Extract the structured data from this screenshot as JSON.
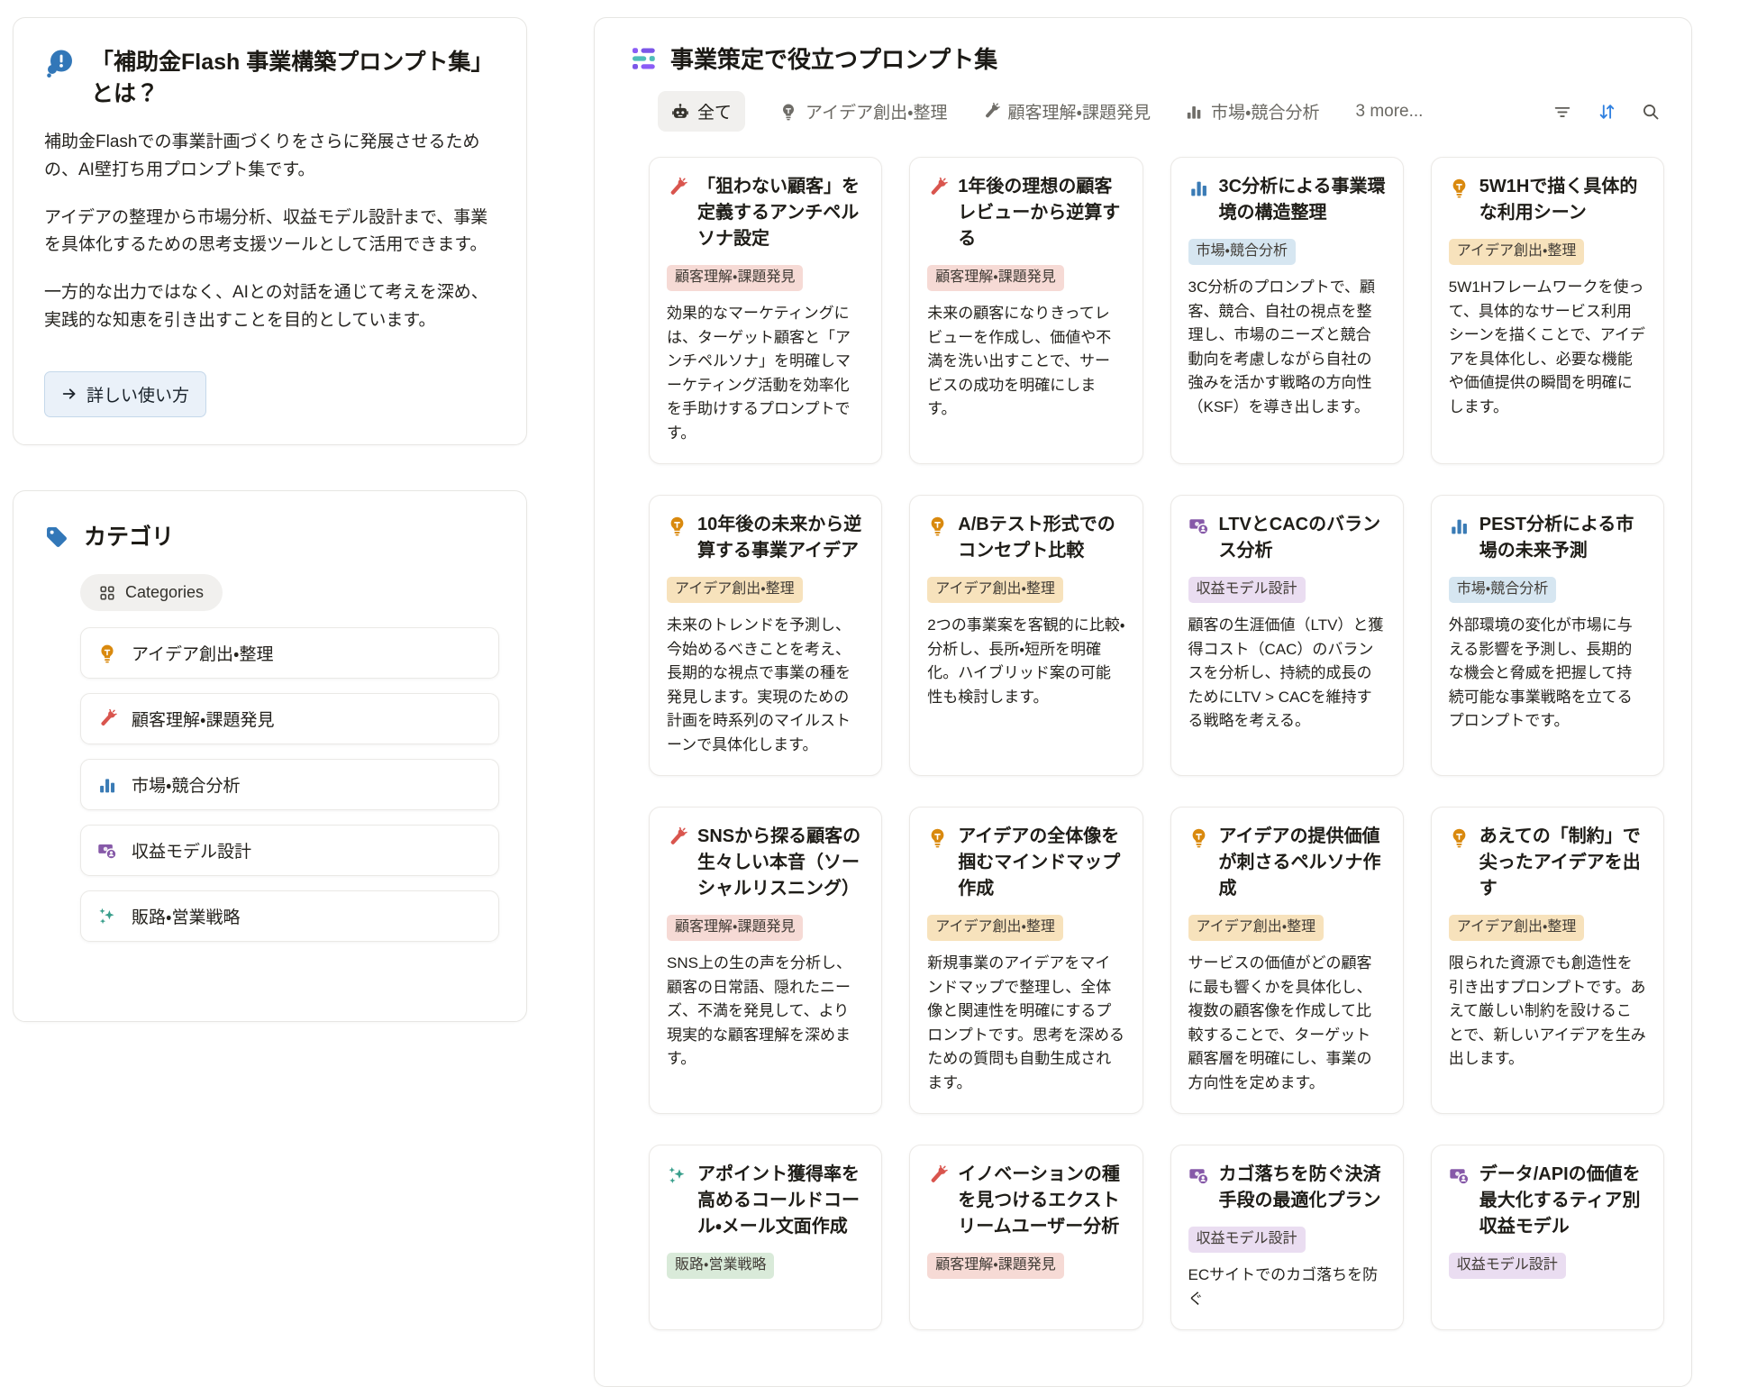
{
  "info_card": {
    "title": "「補助金Flash 事業構築プロンプト集」とは？",
    "paragraphs": [
      "補助金Flashでの事業計画づくりをさらに発展させるための、AI壁打ち用プロンプト集です。",
      "アイデアの整理から市場分析、収益モデル設計まで、事業を具体化するための思考支援ツールとして活用できます。",
      "一方的な出力ではなく、AIとの対話を通じて考えを深め、実践的な知恵を引き出すことを目的としています。"
    ],
    "button_label": "詳しい使い方"
  },
  "categories_card": {
    "title": "カテゴリ",
    "pill_label": "Categories",
    "items": [
      {
        "icon": "lightbulb-icon",
        "label": "アイデア創出・整理"
      },
      {
        "icon": "flashlight-icon",
        "label": "顧客理解・課題発見"
      },
      {
        "icon": "bar-chart-icon",
        "label": "市場・競合分析"
      },
      {
        "icon": "money-icon",
        "label": "収益モデル設計"
      },
      {
        "icon": "sparkles-icon",
        "label": "販路・営業戦略"
      }
    ]
  },
  "main": {
    "title": "事業策定で役立つプロンプト集",
    "tabs": [
      {
        "icon": "robot-icon",
        "label": "全て",
        "active": true
      },
      {
        "icon": "lightbulb-icon",
        "label": "アイデア創出・整理",
        "active": false
      },
      {
        "icon": "flashlight-icon",
        "label": "顧客理解・課題発見",
        "active": false
      },
      {
        "icon": "bar-chart-icon",
        "label": "市場・競合分析",
        "active": false
      }
    ],
    "more_label": "3 more...",
    "cards": [
      {
        "icon": "flashlight-icon",
        "title": "「狙わない顧客」を定義するアンチペルソナ設定",
        "tag": "顧客理解・課題発見",
        "tag_color": "red",
        "description": "効果的なマーケティングには、ターゲット顧客と「アンチペルソナ」を明確しマーケティング活動を効率化を手助けするプロンプトです。"
      },
      {
        "icon": "flashlight-icon",
        "title": "1年後の理想の顧客レビューから逆算する",
        "tag": "顧客理解・課題発見",
        "tag_color": "red",
        "description": "未来の顧客になりきってレビューを作成し、価値や不満を洗い出すことで、サービスの成功を明確にします。"
      },
      {
        "icon": "bar-chart-icon",
        "title": "3C分析による事業環境の構造整理",
        "tag": "市場・競合分析",
        "tag_color": "blue",
        "description": "3C分析のプロンプトで、顧客、競合、自社の視点を整理し、市場のニーズと競合動向を考慮しながら自社の強みを活かす戦略の方向性（KSF）を導き出します。"
      },
      {
        "icon": "lightbulb-icon",
        "title": "5W1Hで描く具体的な利用シーン",
        "tag": "アイデア創出・整理",
        "tag_color": "yellow",
        "description": "5W1Hフレームワークを使って、具体的なサービス利用シーンを描くことで、アイデアを具体化し、必要な機能や価値提供の瞬間を明確にします。"
      },
      {
        "icon": "lightbulb-icon",
        "title": "10年後の未来から逆算する事業アイデア",
        "tag": "アイデア創出・整理",
        "tag_color": "yellow",
        "description": "未来のトレンドを予測し、今始めるべきことを考え、長期的な視点で事業の種を発見します。実現のための計画を時系列のマイルストーンで具体化します。"
      },
      {
        "icon": "lightbulb-icon",
        "title": "A/Bテスト形式でのコンセプト比較",
        "tag": "アイデア創出・整理",
        "tag_color": "yellow",
        "description": "2つの事業案を客観的に比較・分析し、長所・短所を明確化。ハイブリッド案の可能性も検討します。"
      },
      {
        "icon": "money-icon",
        "title": "LTVとCACのバランス分析",
        "tag": "収益モデル設計",
        "tag_color": "purple",
        "description": "顧客の生涯価値（LTV）と獲得コスト（CAC）のバランスを分析し、持続的成長のためにLTV > CACを維持する戦略を考える。"
      },
      {
        "icon": "bar-chart-icon",
        "title": "PEST分析による市場の未来予測",
        "tag": "市場・競合分析",
        "tag_color": "blue",
        "description": "外部環境の変化が市場に与える影響を予測し、長期的な機会と脅威を把握して持続可能な事業戦略を立てるプロンプトです。"
      },
      {
        "icon": "flashlight-icon",
        "title": "SNSから探る顧客の生々しい本音（ソーシャルリスニング）",
        "tag": "顧客理解・課題発見",
        "tag_color": "red",
        "description": "SNS上の生の声を分析し、顧客の日常語、隠れたニーズ、不満を発見して、より現実的な顧客理解を深めます。"
      },
      {
        "icon": "lightbulb-icon",
        "title": "アイデアの全体像を掴むマインドマップ作成",
        "tag": "アイデア創出・整理",
        "tag_color": "yellow",
        "description": "新規事業のアイデアをマインドマップで整理し、全体像と関連性を明確にするプロンプトです。思考を深めるための質問も自動生成されます。"
      },
      {
        "icon": "lightbulb-icon",
        "title": "アイデアの提供価値が刺さるペルソナ作成",
        "tag": "アイデア創出・整理",
        "tag_color": "yellow",
        "description": "サービスの価値がどの顧客に最も響くかを具体化し、複数の顧客像を作成して比較することで、ターゲット顧客層を明確にし、事業の方向性を定めます。"
      },
      {
        "icon": "lightbulb-icon",
        "title": "あえての「制約」で尖ったアイデアを出す",
        "tag": "アイデア創出・整理",
        "tag_color": "yellow",
        "description": "限られた資源でも創造性を引き出すプロンプトです。あえて厳しい制約を設けることで、新しいアイデアを生み出します。"
      },
      {
        "icon": "sparkles-icon",
        "title": "アポイント獲得率を高めるコールドコール・メール文面作成",
        "tag": "販路・営業戦略",
        "tag_color": "green",
        "description": ""
      },
      {
        "icon": "flashlight-icon",
        "title": "イノベーションの種を見つけるエクストリームユーザー分析",
        "tag": "顧客理解・課題発見",
        "tag_color": "red",
        "description": ""
      },
      {
        "icon": "money-icon",
        "title": "カゴ落ちを防ぐ決済手段の最適化プラン",
        "tag": "収益モデル設計",
        "tag_color": "purple",
        "description": "ECサイトでのカゴ落ちを防ぐ"
      },
      {
        "icon": "money-icon",
        "title": "データ/APIの価値を最大化するティア別収益モデル",
        "tag": "収益モデル設計",
        "tag_color": "purple",
        "description": ""
      }
    ]
  },
  "colors": {
    "tag_red": "#F6DAD5",
    "tag_blue": "#D6E6F1",
    "tag_yellow": "#F7E2BC",
    "tag_purple": "#EADDF1",
    "tag_green": "#D9EAD9",
    "icon_orange": "#D9890E",
    "icon_red": "#D9554E",
    "icon_blue": "#3A7BB5",
    "icon_purple": "#8659A8",
    "icon_teal": "#379E8B",
    "icon_dark": "#35332D",
    "icon_gray": "#6F6D68",
    "accent_blue": "#2F80E0",
    "info_blue": "#3277B8"
  }
}
